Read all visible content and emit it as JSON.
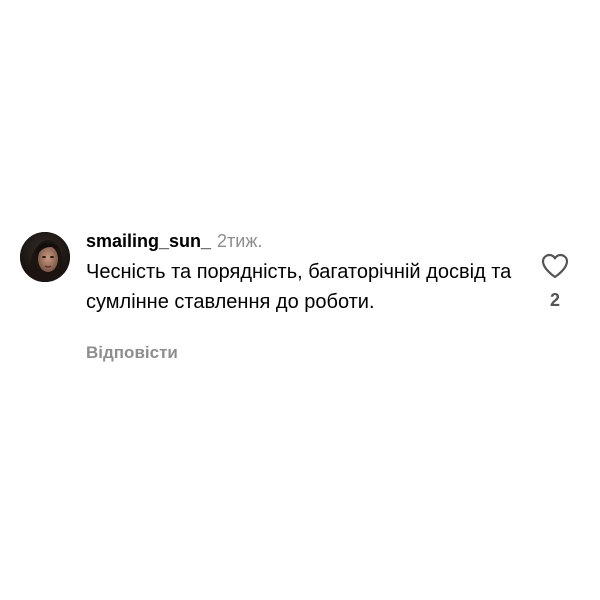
{
  "comment": {
    "username": "smailing_sun_",
    "timestamp": "2тиж.",
    "text": "Чесність та порядність, багаторічній досвід та сумлінне ставлення до роботи.",
    "reply_label": "Відповісти",
    "like_count": "2",
    "avatar": "user-avatar-photo",
    "like_icon": "heart-outline-icon"
  },
  "colors": {
    "background": "#ffffff",
    "text": "#000000",
    "muted": "#8e8e8e"
  }
}
